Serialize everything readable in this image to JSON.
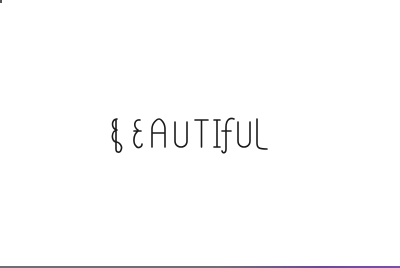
{
  "word": {
    "text": "BEAUTIFUL",
    "color": "#1a1a1a"
  },
  "bottom_bar": {
    "colors": [
      "#6e6e74",
      "#7a4fb0"
    ]
  }
}
